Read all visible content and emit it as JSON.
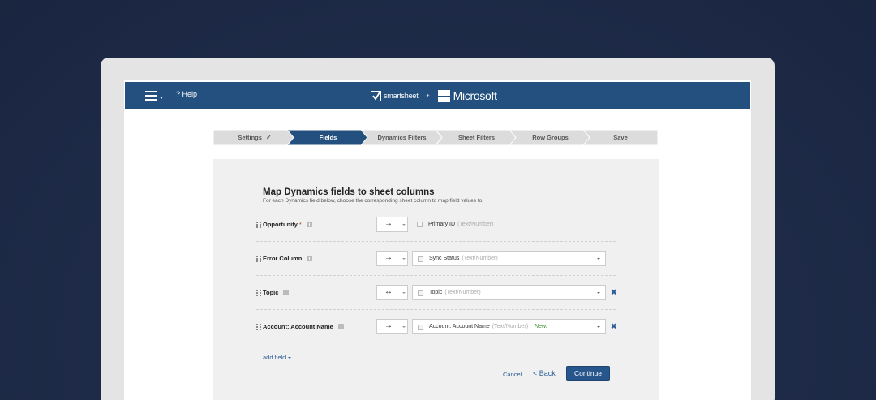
{
  "header": {
    "help_label": "? Help",
    "smartsheet_label": "smartsheet",
    "plus_label": "+",
    "microsoft_label": "Microsoft"
  },
  "steps": [
    {
      "label": "Settings",
      "state": "done"
    },
    {
      "label": "Fields",
      "state": "active"
    },
    {
      "label": "Dynamics Filters",
      "state": "pending"
    },
    {
      "label": "Sheet Filters",
      "state": "pending"
    },
    {
      "label": "Row Groups",
      "state": "pending"
    },
    {
      "label": "Save",
      "state": "pending"
    }
  ],
  "check_mark": "✓",
  "main": {
    "title": "Map Dynamics fields to sheet columns",
    "subtitle": "For each Dynamics field below, choose the corresponding sheet column to map field values to."
  },
  "mappings": [
    {
      "field": "Opportunity",
      "required": "*",
      "direction": "→",
      "column": "Primary ID",
      "type": "(Text/Number)",
      "new": "",
      "remove": ""
    },
    {
      "field": "Error Column",
      "required": "",
      "direction": "→",
      "column": "Sync Status",
      "type": "(Text/Number)",
      "new": "",
      "remove": ""
    },
    {
      "field": "Topic",
      "required": "",
      "direction": "↔",
      "column": "Topic",
      "type": "(Text/Number)",
      "new": "",
      "remove": "✖"
    },
    {
      "field": "Account: Account Name",
      "required": "",
      "direction": "→",
      "column": "Account: Account Name",
      "type": "(Text/Number)",
      "new": "New!",
      "remove": "✖"
    }
  ],
  "actions": {
    "add_field": "add field",
    "cancel": "Cancel",
    "back": "< Back",
    "continue": "Continue"
  },
  "colors": {
    "header_bg": "#23507e",
    "active_step": "#23507e",
    "pending_step": "#dcdcdc",
    "link": "#2f5f96",
    "new_badge": "#3a8c2a"
  }
}
